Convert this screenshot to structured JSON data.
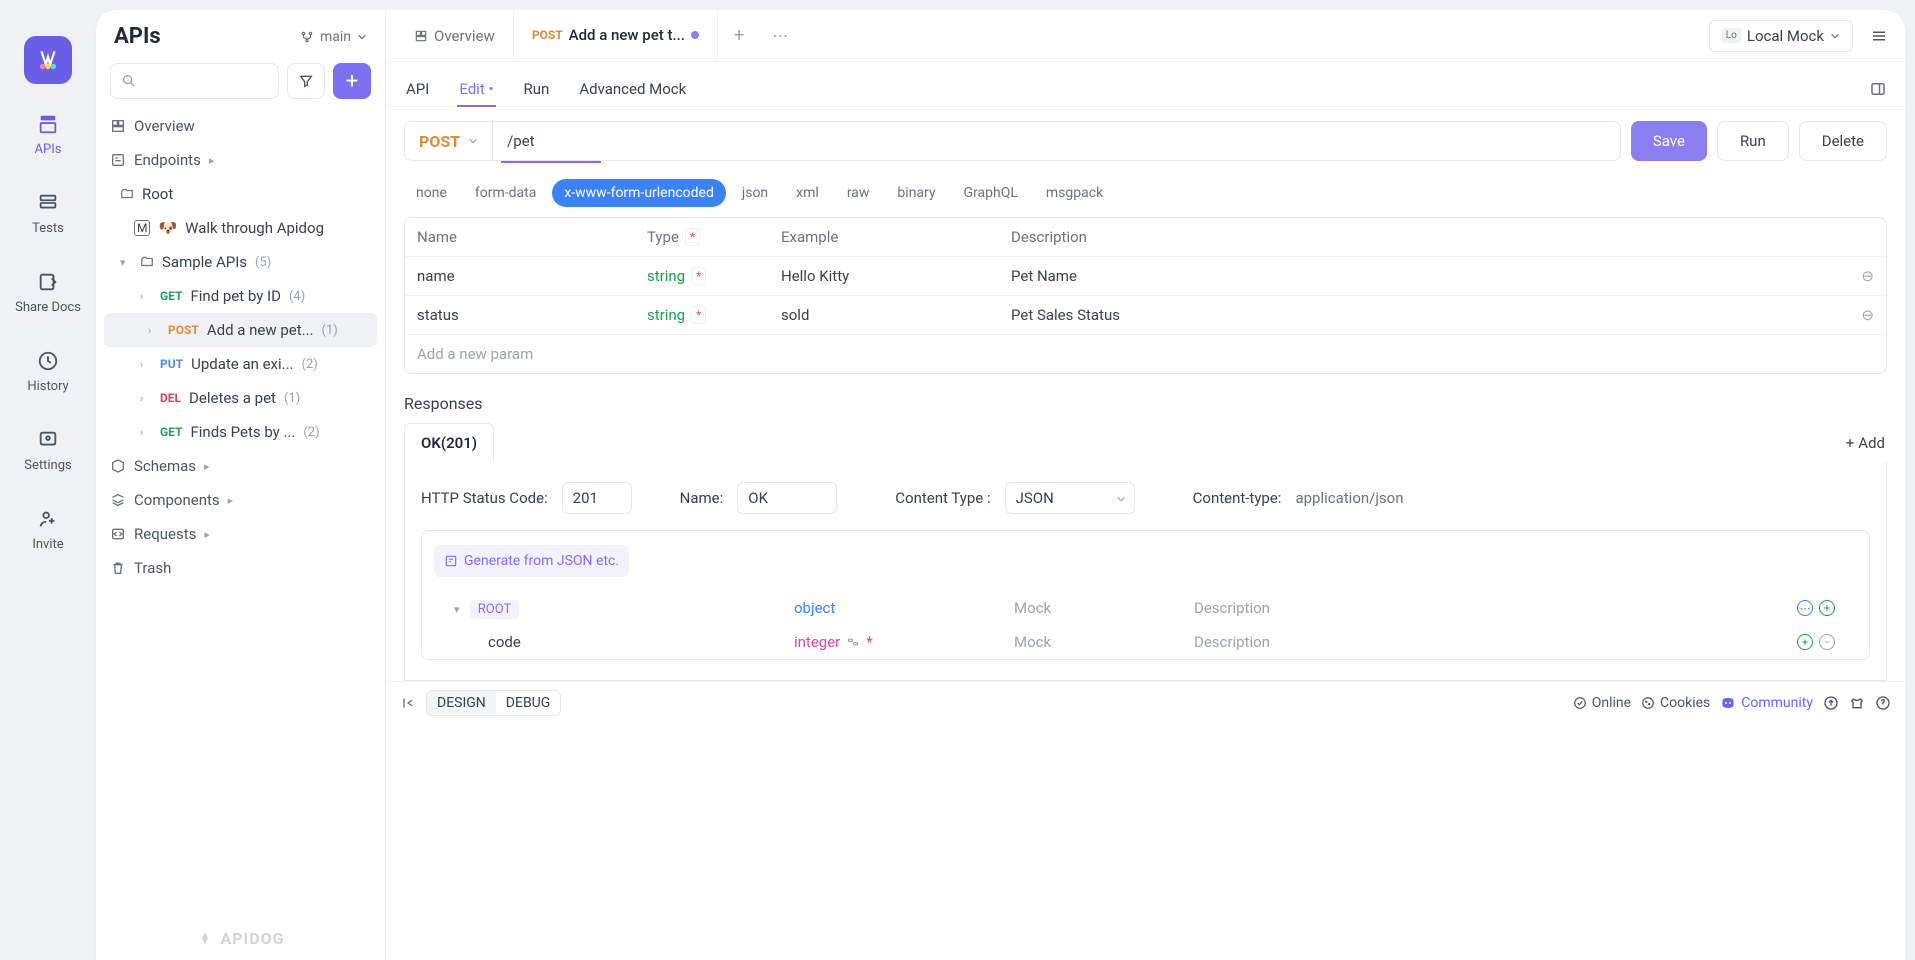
{
  "rail": {
    "apis": "APIs",
    "tests": "Tests",
    "share": "Share Docs",
    "history": "History",
    "settings": "Settings",
    "invite": "Invite"
  },
  "side": {
    "title": "APIs",
    "branch": "main",
    "overview": "Overview",
    "endpoints": "Endpoints",
    "root": "Root",
    "walkthrough": "Walk through Apidog",
    "sample_apis": "Sample APIs",
    "sample_count": "(5)",
    "items": {
      "find": {
        "method": "GET",
        "label": "Find pet by ID",
        "count": "(4)"
      },
      "add": {
        "method": "POST",
        "label": "Add a new pet...",
        "count": "(1)"
      },
      "upd": {
        "method": "PUT",
        "label": "Update an exi...",
        "count": "(2)"
      },
      "del": {
        "method": "DEL",
        "label": "Deletes a pet",
        "count": "(1)"
      },
      "find2": {
        "method": "GET",
        "label": "Finds Pets by ...",
        "count": "(2)"
      }
    },
    "schemas": "Schemas",
    "components": "Components",
    "requests": "Requests",
    "trash": "Trash",
    "brand": "APIDOG"
  },
  "tabs": {
    "overview": "Overview",
    "active": {
      "method": "POST",
      "title": "Add a new pet t..."
    },
    "env_lo": "Lo",
    "env": "Local Mock"
  },
  "subtabs": {
    "api": "API",
    "edit": "Edit",
    "edit_mod": "•",
    "run": "Run",
    "mock": "Advanced Mock"
  },
  "url": {
    "method": "POST",
    "path": "/pet"
  },
  "buttons": {
    "save": "Save",
    "run": "Run",
    "delete": "Delete"
  },
  "body_tabs": {
    "none": "none",
    "form": "form-data",
    "url": "x-www-form-urlencoded",
    "json": "json",
    "xml": "xml",
    "raw": "raw",
    "binary": "binary",
    "graphql": "GraphQL",
    "msgpack": "msgpack"
  },
  "params": {
    "head": {
      "name": "Name",
      "type": "Type",
      "example": "Example",
      "desc": "Description"
    },
    "rows": [
      {
        "name": "name",
        "type": "string",
        "example": "Hello Kitty",
        "desc": "Pet Name"
      },
      {
        "name": "status",
        "type": "string",
        "example": "sold",
        "desc": "Pet Sales Status"
      }
    ],
    "add": "Add a new param"
  },
  "responses": {
    "title": "Responses",
    "tab": "OK(201)",
    "add": "Add",
    "status_lbl": "HTTP Status Code:",
    "status_val": "201",
    "name_lbl": "Name:",
    "name_val": "OK",
    "ct_lbl": "Content Type :",
    "ct_val": "JSON",
    "cth_lbl": "Content-type:",
    "cth_val": "application/json",
    "generate": "Generate from JSON etc.",
    "schema": {
      "root": "ROOT",
      "root_type": "object",
      "row_mock": "Mock",
      "row_desc": "Description",
      "code": "code",
      "code_type": "integer"
    }
  },
  "footer": {
    "design": "DESIGN",
    "debug": "DEBUG",
    "online": "Online",
    "cookies": "Cookies",
    "community": "Community"
  }
}
